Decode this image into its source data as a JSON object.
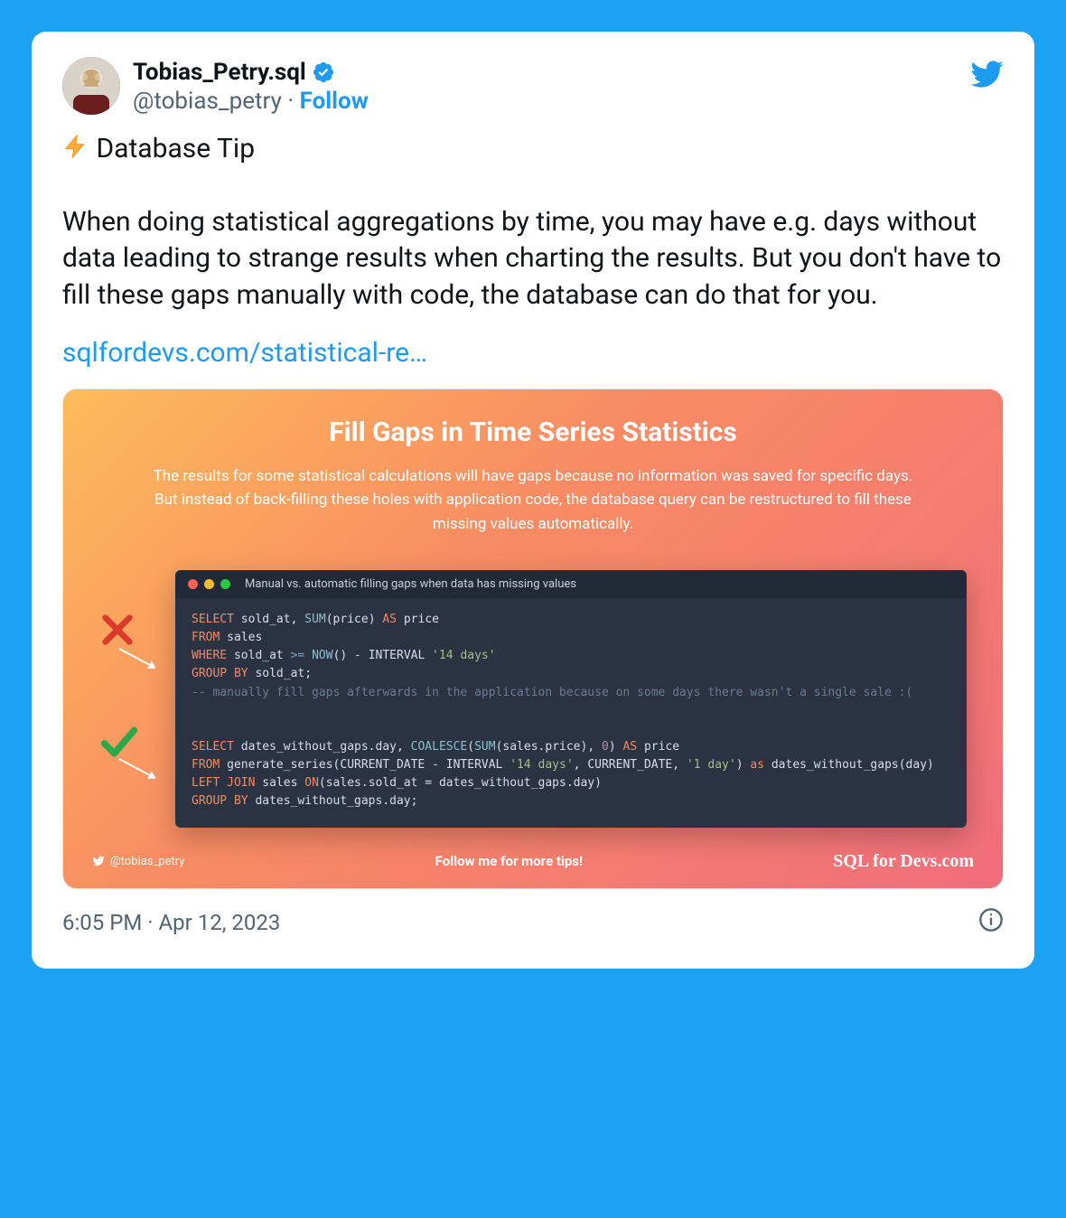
{
  "tweet": {
    "author": {
      "display_name": "Tobias_Petry.sql",
      "handle": "@tobias_petry",
      "verified": true
    },
    "follow_label": "Follow",
    "separator": " · ",
    "body": {
      "title_line": "Database Tip",
      "para2": "When doing statistical aggregations by time, you may have e.g. days without data leading to strange results when charting the results. But you don't have to fill these gaps manually with code, the database can do that for you."
    },
    "link_text": "sqlfordevs.com/statistical-re…",
    "timestamp": "6:05 PM · Apr 12, 2023"
  },
  "embed": {
    "title": "Fill Gaps in Time Series Statistics",
    "description": "The results for some statistical calculations will have gaps because no information was saved for specific days. But instead of back-filling these holes with application code, the database query can be restructured to fill these missing values automatically.",
    "window_title": "Manual vs. automatic filling gaps when data has missing values",
    "footer": {
      "handle": "@tobias_petry",
      "tips": "Follow me for more tips!",
      "brand": "SQL for Devs.com"
    },
    "code": {
      "block1": {
        "l1_select": "SELECT",
        "l1_rest": " sold_at, ",
        "l1_sum": "SUM",
        "l1_price": "(price) ",
        "l1_as": "AS",
        "l1_alias": " price",
        "l2_from": "FROM",
        "l2_rest": " sales",
        "l3_where": "WHERE",
        "l3_rest": " sold_at ",
        "l3_op": ">=",
        "l3_now": " NOW",
        "l3_after": "() - INTERVAL ",
        "l3_str": "'14 days'",
        "l4_group": "GROUP BY",
        "l4_rest": " sold_at;",
        "l5_comment": "-- manually fill gaps afterwards in the application because on some days there wasn't a single sale :("
      },
      "block2": {
        "l1_select": "SELECT",
        "l1_rest": " dates_without_gaps.day, ",
        "l1_coalesce": "COALESCE",
        "l1_p1": "(",
        "l1_sum": "SUM",
        "l1_p2": "(sales.price), ",
        "l1_zero": "0",
        "l1_p3": ") ",
        "l1_as": "AS",
        "l1_alias": " price",
        "l2_from": "FROM",
        "l2_rest": " generate_series(CURRENT_DATE - INTERVAL ",
        "l2_str1": "'14 days'",
        "l2_mid": ", CURRENT_DATE, ",
        "l2_str2": "'1 day'",
        "l2_end": ") ",
        "l2_as": "as",
        "l2_alias": " dates_without_gaps(day)",
        "l3_join": "LEFT JOIN",
        "l3_rest": " sales ",
        "l3_on": "ON",
        "l3_cond": "(sales.sold_at = dates_without_gaps.day)",
        "l4_group": "GROUP BY",
        "l4_rest": " dates_without_gaps.day;"
      }
    }
  }
}
